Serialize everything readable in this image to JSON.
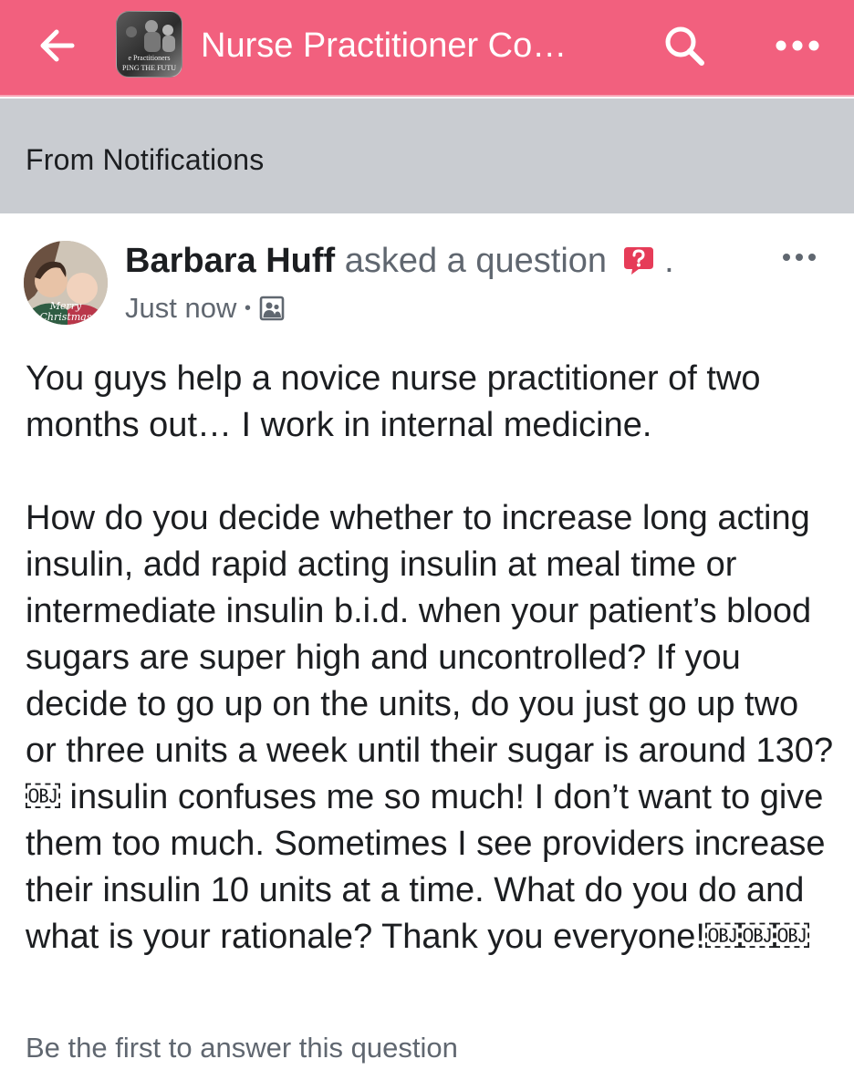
{
  "header": {
    "title": "Nurse Practitioner Co…",
    "thumbnail_text_line1": "e Practitioners",
    "thumbnail_text_line2": "PING THE FUTU",
    "icons": [
      "back-arrow-icon",
      "search-icon",
      "more-icon"
    ],
    "background_color": "#f2607e"
  },
  "banner": {
    "label": "From Notifications",
    "background_color": "#c9ccd1"
  },
  "post": {
    "author": "Barbara Huff",
    "action": "asked a question",
    "after_icon": ".",
    "avatar_caption": "Merry Christmas",
    "timestamp": "Just now",
    "separator": "•",
    "privacy_icon": "group-members-icon",
    "paragraphs": [
      "You guys help a novice nurse practitioner of two months out… I work in internal medicine.",
      "How do you decide whether to increase long acting insulin, add rapid acting insulin at meal time or intermediate insulin b.i.d. when your patient’s blood sugars are super high and uncontrolled? If you decide to go up on the units, do you just go up two or three units a week until their sugar is around 130?￼ insulin confuses me so much! I don’t want to give them too much. Sometimes I see providers increase their insulin 10 units at a time. What do you do and what is your rationale? Thank you everyone!￼￼￼"
    ],
    "answer_prompt": "Be the first to answer this question"
  }
}
